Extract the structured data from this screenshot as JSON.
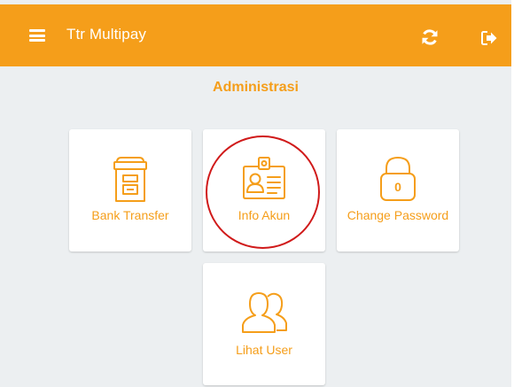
{
  "header": {
    "title": "Ttr Multipay",
    "menu_icon": "hamburger-menu-icon",
    "refresh_icon": "refresh-icon",
    "logout_icon": "logout-icon"
  },
  "section": {
    "title": "Administrasi"
  },
  "cards": [
    {
      "label": "Bank Transfer",
      "icon": "archive-box-icon"
    },
    {
      "label": "Info Akun",
      "icon": "id-card-icon"
    },
    {
      "label": "Change Password",
      "icon": "padlock-icon",
      "icon_text": "0"
    },
    {
      "label": "Lihat User",
      "icon": "users-icon"
    }
  ],
  "colors": {
    "accent": "#f59e1a",
    "background": "#eceff1",
    "card": "#ffffff",
    "highlight": "#d01a1a"
  }
}
